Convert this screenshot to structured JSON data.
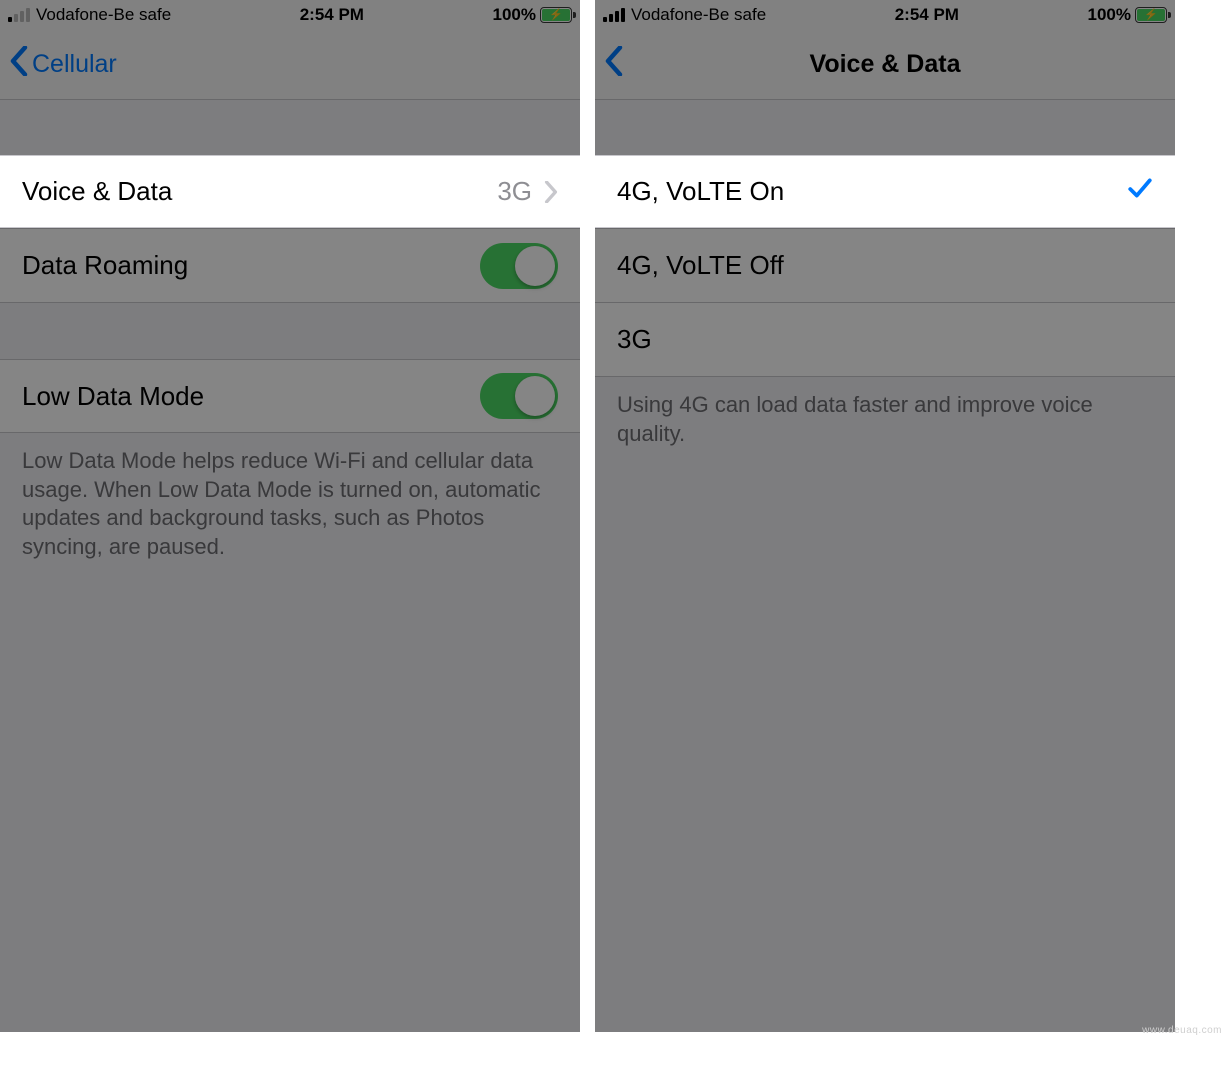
{
  "statusbar": {
    "carrier": "Vodafone-Be safe",
    "time": "2:54 PM",
    "battery_pct": "100%"
  },
  "left": {
    "back_label": "Cellular",
    "voice_data": {
      "label": "Voice & Data",
      "value": "3G"
    },
    "data_roaming_label": "Data Roaming",
    "low_data_mode_label": "Low Data Mode",
    "low_data_footer": "Low Data Mode helps reduce Wi-Fi and cellular data usage. When Low Data Mode is turned on, automatic updates and background tasks, such as Photos syncing, are paused."
  },
  "right": {
    "title": "Voice & Data",
    "options": {
      "opt0": "4G, VoLTE On",
      "opt1": "4G, VoLTE Off",
      "opt2": "3G"
    },
    "footer": "Using 4G can load data faster and improve voice quality."
  },
  "watermark": "www.deuaq.com"
}
